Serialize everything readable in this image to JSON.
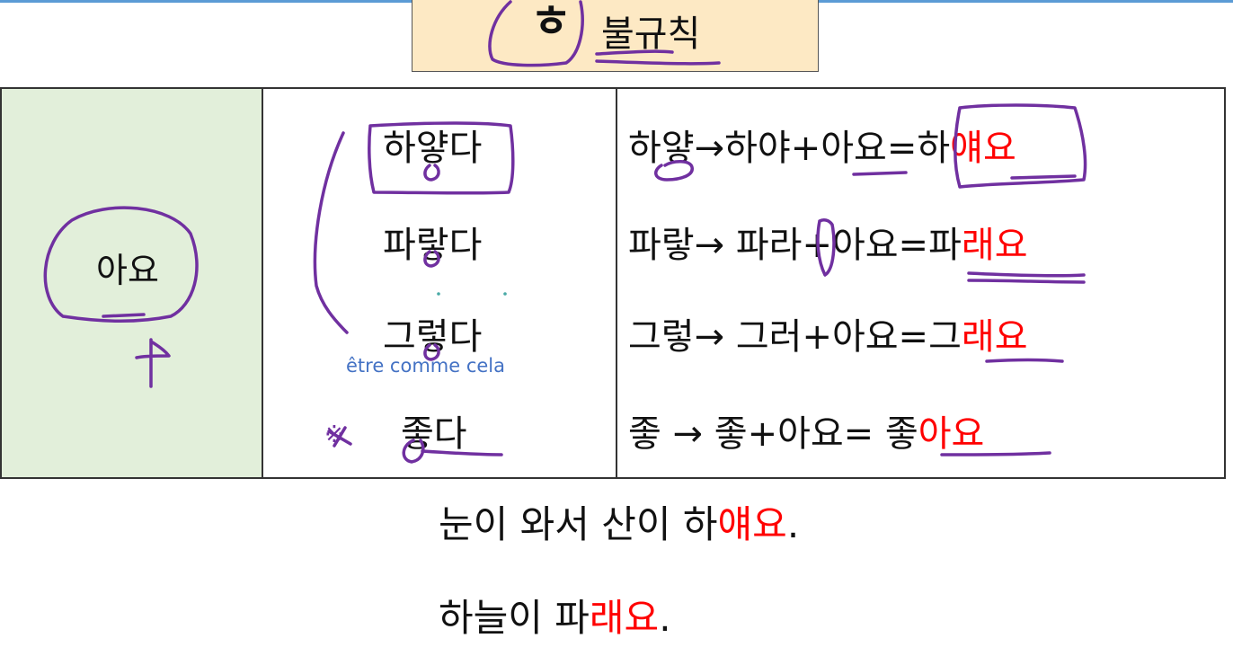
{
  "title": {
    "hieut": "ㅎ",
    "rest": "불규칙"
  },
  "table": {
    "ending": "아요",
    "words": [
      "하얗다",
      "파랗다",
      "그렇다",
      "좋다"
    ],
    "note": "être comme cela",
    "exception_mark": "※",
    "conversions": [
      {
        "stem": "하얗",
        "arrow": "→",
        "step": "하야+아요=",
        "result_plain": "하",
        "result_red": "얘요"
      },
      {
        "stem": "파랗",
        "arrow": "→ ",
        "step": "파라+아요=",
        "result_plain": "파",
        "result_red": "래요"
      },
      {
        "stem": "그렇",
        "arrow": "→ ",
        "step": "그러+아요=",
        "result_plain": "그",
        "result_red": "래요"
      },
      {
        "stem": "좋",
        "arrow": "   → ",
        "step": "좋+아요= ",
        "result_plain": "좋",
        "result_red": "아요"
      }
    ]
  },
  "sentences": [
    {
      "plain": "눈이 와서 산이 하",
      "red": "얘요",
      "end": "."
    },
    {
      "plain": "하늘이 파",
      "red": "래요",
      "end": "."
    }
  ],
  "colors": {
    "ink": "#7030a0",
    "red": "#ff0000",
    "title_bg": "#fde9c4",
    "col1_bg": "#e2efda",
    "note": "#4472c4"
  }
}
